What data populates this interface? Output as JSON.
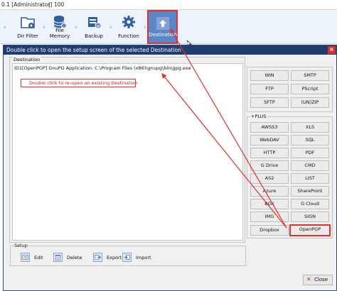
{
  "titlebar": {
    "app_title": "0.1 [Administrator]",
    "separator": "|",
    "number": "100"
  },
  "toolbar": {
    "buttons": [
      {
        "label": "Dir Filter",
        "icon": "folder-gear-icon"
      },
      {
        "label": "File Memory",
        "icon": "database-icon"
      },
      {
        "label": "Backup",
        "icon": "backup-drive-icon"
      },
      {
        "label": "Function",
        "icon": "gear-icon"
      },
      {
        "label": "Destination",
        "icon": "upload-icon"
      }
    ]
  },
  "dialog": {
    "title": "Double click to open the setup screen of the selected Destination",
    "close_glyph": "×",
    "destination_group_label": "Destination",
    "destination_entry": "ID1[OpenPGP] GnuPG Application: C:\\Program Files (x86)\\gnupg\\bin\\gpg.exe",
    "hint": "Double click to re-open an existing Destination",
    "standard_buttons": [
      "WIN",
      "SMTP",
      "FTP",
      "PScript",
      "SFTP",
      "(UN)ZIP"
    ],
    "plus_group_label": "+PLUS",
    "plus_buttons": [
      "AWSS3",
      "XLS",
      "WebDAV",
      "SQL",
      "HTTP",
      "PDF",
      "G Drive",
      "CMD",
      "AS2",
      "LIST",
      "Azure",
      "SharePoint",
      "BOX",
      "G Cloud",
      "IMG",
      "SIGN",
      "Dropbox",
      "OpenPGP"
    ],
    "setup_group_label": "Setup",
    "setup_buttons": [
      {
        "label": "Edit",
        "icon": "edit-icon"
      },
      {
        "label": "Delete",
        "icon": "trash-icon"
      },
      {
        "label": "Export",
        "icon": "export-icon"
      },
      {
        "label": "Import",
        "icon": "import-icon"
      }
    ],
    "close_label": "Close",
    "close_icon_glyph": "✕"
  },
  "colors": {
    "accent": "#5d86c9",
    "highlight": "#e03030",
    "dialog_title": "#1f3d70"
  }
}
